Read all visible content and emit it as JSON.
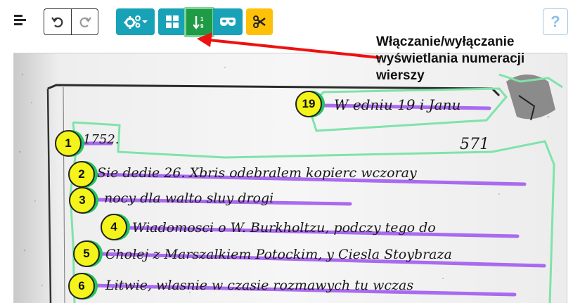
{
  "toolbar": {
    "menu_icon": "menu-lines-icon",
    "undo_icon": "undo-icon",
    "redo_icon": "redo-icon",
    "settings_icon": "gears-dropdown-icon",
    "layout_icon": "grid-icon",
    "numbering_icon": "sort-numeric-icon",
    "mask_icon": "mask-icon",
    "cut_icon": "scissors-icon",
    "help_label": "?"
  },
  "tooltip": {
    "text": "Włączanie/wyłączanie wyświetlania numeracji wierszy"
  },
  "document": {
    "line_numbers": [
      {
        "label": "19"
      },
      {
        "label": "1"
      },
      {
        "label": "2"
      },
      {
        "label": "3"
      },
      {
        "label": "4"
      },
      {
        "label": "5"
      },
      {
        "label": "6"
      }
    ],
    "handwritten_lines": [
      "W edniu 19 i Janu",
      "1752.",
      "Sie dedie 26. Xbris odebralem kopierc wczoray",
      "nocy dla walto sluy drogi",
      "Wiadomosci o W. Burkholtzu, podczy tego do",
      "Cholej z Marszalkiem Potockim, y Ciesla Stoybraza",
      "Litwie, wlasnie w czasie rozmawych tu wczas"
    ],
    "page_number": "571"
  },
  "colors": {
    "accent_teal": "#17a2b8",
    "active_green": "#1f9a45",
    "warning_yellow": "#ffc107",
    "region_outline": "#7fe3a9",
    "baseline_purple": "#a25cf0",
    "marker_yellow": "#f4f41a",
    "arrow_red": "#ee1111"
  }
}
